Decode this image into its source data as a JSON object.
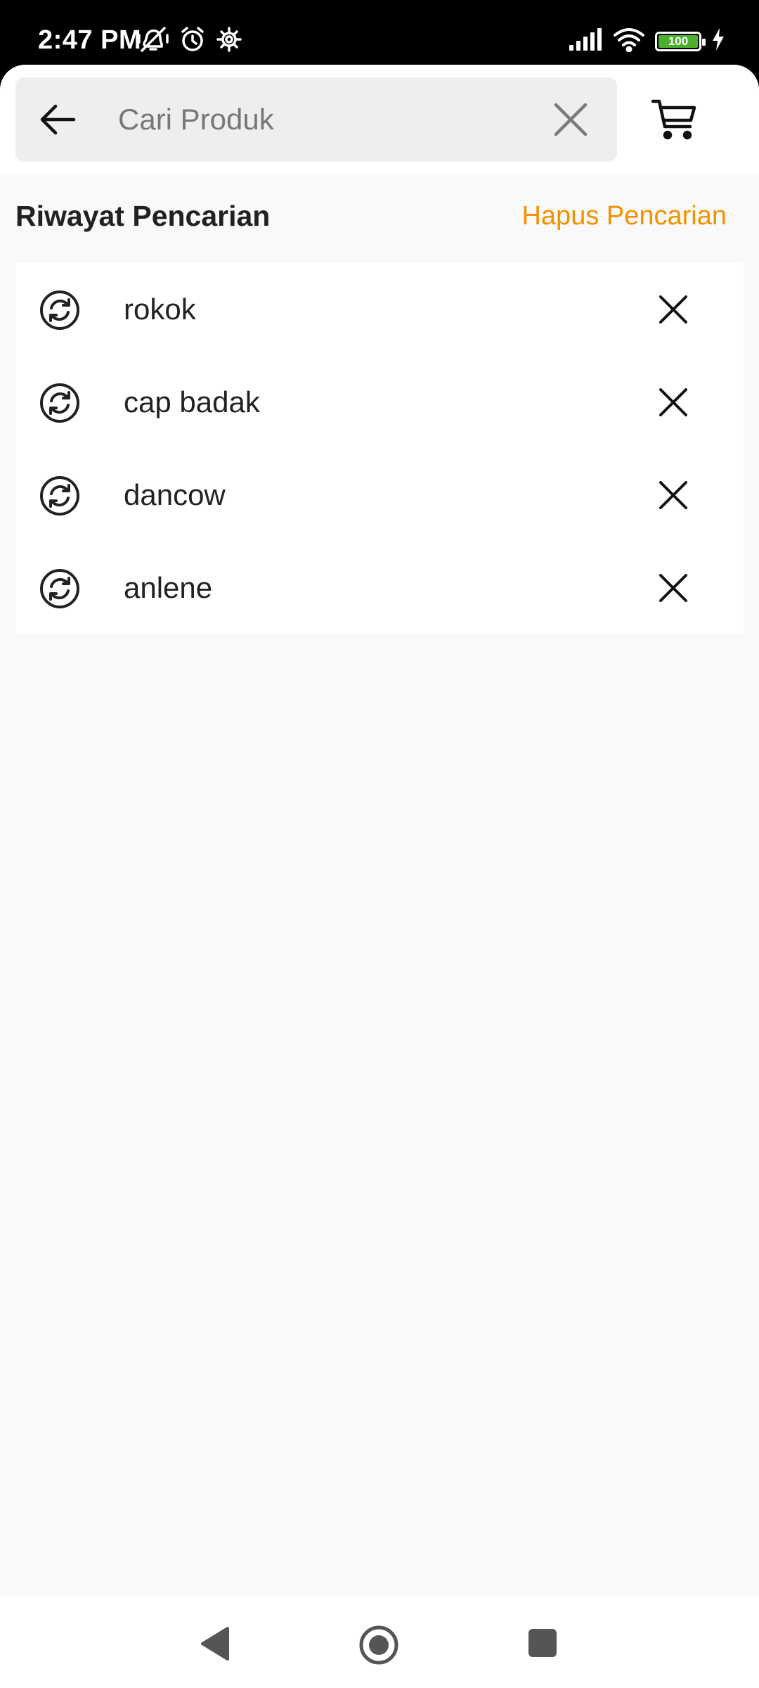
{
  "status_bar": {
    "time": "2:47 PM",
    "battery_level": "100",
    "icons": [
      "vibrate-off-icon",
      "alarm-icon",
      "settings-icon",
      "signal-icon",
      "wifi-icon",
      "battery-icon",
      "charging-icon"
    ]
  },
  "search": {
    "placeholder": "Cari Produk",
    "value": ""
  },
  "history": {
    "title": "Riwayat Pencarian",
    "clear_label": "Hapus Pencarian",
    "items": [
      {
        "label": "rokok"
      },
      {
        "label": "cap badak"
      },
      {
        "label": "dancow"
      },
      {
        "label": "anlene"
      }
    ]
  },
  "colors": {
    "accent": "#f39200",
    "battery": "#4caf2f"
  }
}
